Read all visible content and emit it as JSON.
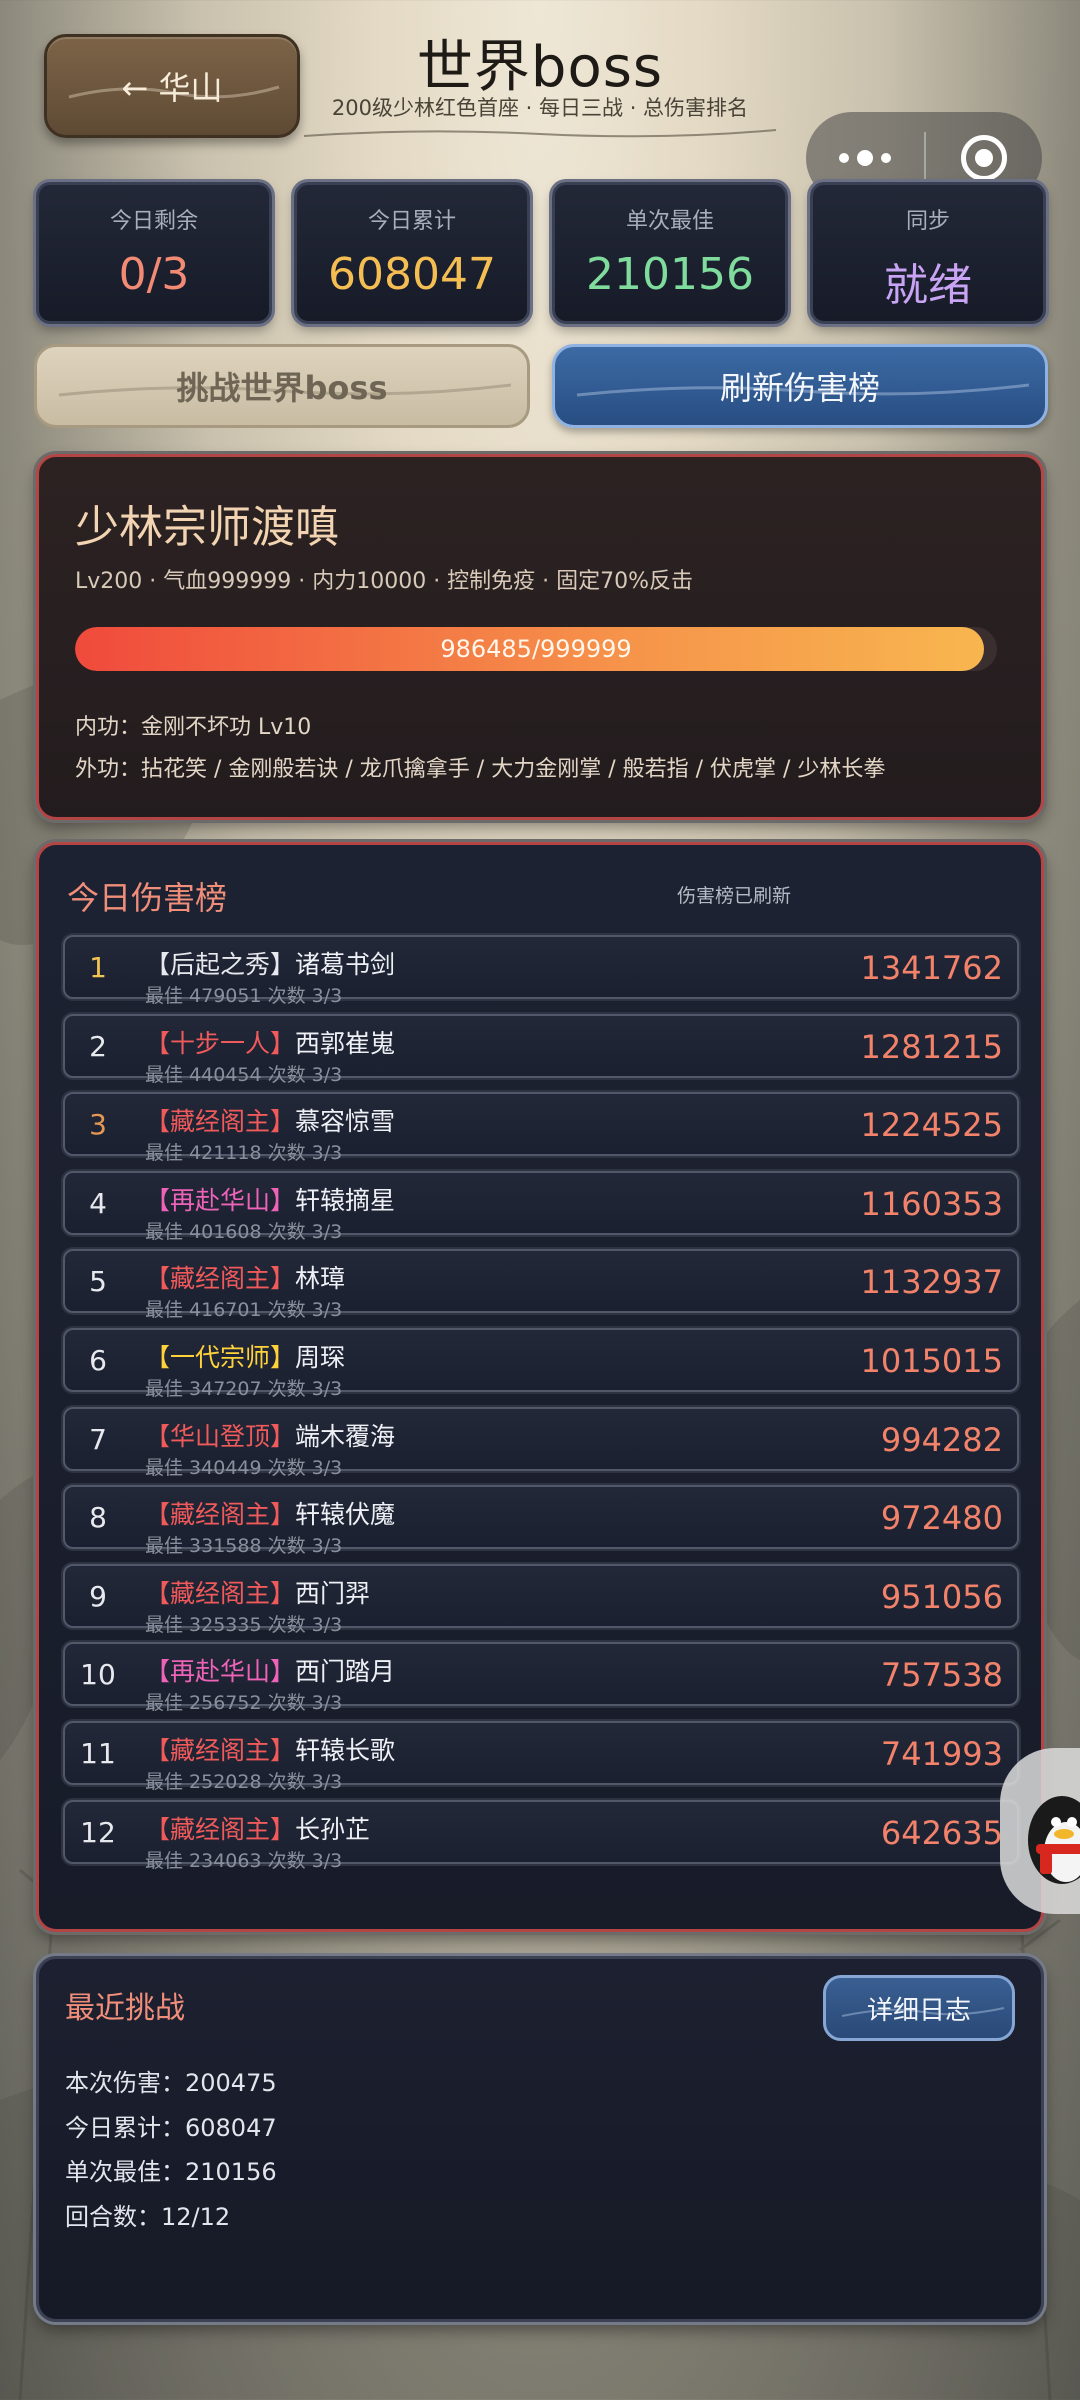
{
  "header": {
    "back_label": "← 华山",
    "title": "世界boss",
    "subtitle": "200级少林红色首座 · 每日三战 · 总伤害排名"
  },
  "stats": [
    {
      "label": "今日剩余",
      "value": "0/3",
      "color": "#f28a74"
    },
    {
      "label": "今日累计",
      "value": "608047",
      "color": "#f4be52"
    },
    {
      "label": "单次最佳",
      "value": "210156",
      "color": "#7fdc9c"
    },
    {
      "label": "同步",
      "value": "就绪",
      "color": "#c9a4f4"
    }
  ],
  "actions": {
    "challenge_label": "挑战世界boss",
    "refresh_label": "刷新伤害榜"
  },
  "boss": {
    "name": "少林宗师渡嗔",
    "stats_line": "Lv200 · 气血999999 · 内力10000 · 控制免疫 · 固定70%反击",
    "hp_text": "986485/999999",
    "hp_fraction": 0.986,
    "inner_skill": "内功：金刚不坏功 Lv10",
    "outer_skills": "外功：拈花笑 / 金刚般若诀 / 龙爪擒拿手 / 大力金刚掌 / 般若指 / 伏虎掌 / 少林长拳"
  },
  "ranking": {
    "title": "今日伤害榜",
    "status": "伤害榜已刷新",
    "rows": [
      {
        "rank": "1",
        "tag": "【后起之秀】",
        "name": "诸葛书剑",
        "sub": "最佳 479051  次数 3/3",
        "damage": "1341762"
      },
      {
        "rank": "2",
        "tag": "【十步一人】",
        "name": "西郭崔嵬",
        "sub": "最佳 440454  次数 3/3",
        "damage": "1281215"
      },
      {
        "rank": "3",
        "tag": "【藏经阁主】",
        "name": "慕容惊雪",
        "sub": "最佳 421118  次数 3/3",
        "damage": "1224525"
      },
      {
        "rank": "4",
        "tag": "【再赴华山】",
        "name": "轩辕摘星",
        "sub": "最佳 401608  次数 3/3",
        "damage": "1160353"
      },
      {
        "rank": "5",
        "tag": "【藏经阁主】",
        "name": "林璋",
        "sub": "最佳 416701  次数 3/3",
        "damage": "1132937"
      },
      {
        "rank": "6",
        "tag": "【一代宗师】",
        "name": "周琛",
        "sub": "最佳 347207  次数 3/3",
        "damage": "1015015"
      },
      {
        "rank": "7",
        "tag": "【华山登顶】",
        "name": "端木覆海",
        "sub": "最佳 340449  次数 3/3",
        "damage": "994282"
      },
      {
        "rank": "8",
        "tag": "【藏经阁主】",
        "name": "轩辕伏魔",
        "sub": "最佳 331588  次数 3/3",
        "damage": "972480"
      },
      {
        "rank": "9",
        "tag": "【藏经阁主】",
        "name": "西门羿",
        "sub": "最佳 325335  次数 3/3",
        "damage": "951056"
      },
      {
        "rank": "10",
        "tag": "【再赴华山】",
        "name": "西门踏月",
        "sub": "最佳 256752  次数 3/3",
        "damage": "757538"
      },
      {
        "rank": "11",
        "tag": "【藏经阁主】",
        "name": "轩辕长歌",
        "sub": "最佳 252028  次数 3/3",
        "damage": "741993"
      },
      {
        "rank": "12",
        "tag": "【藏经阁主】",
        "name": "长孙芷",
        "sub": "最佳 234063  次数 3/3",
        "damage": "642635"
      }
    ]
  },
  "recent": {
    "title": "最近挑战",
    "log_label": "详细日志",
    "lines": [
      "本次伤害：200475",
      "今日累计：608047",
      "单次最佳：210156",
      "回合数：12/12"
    ]
  }
}
